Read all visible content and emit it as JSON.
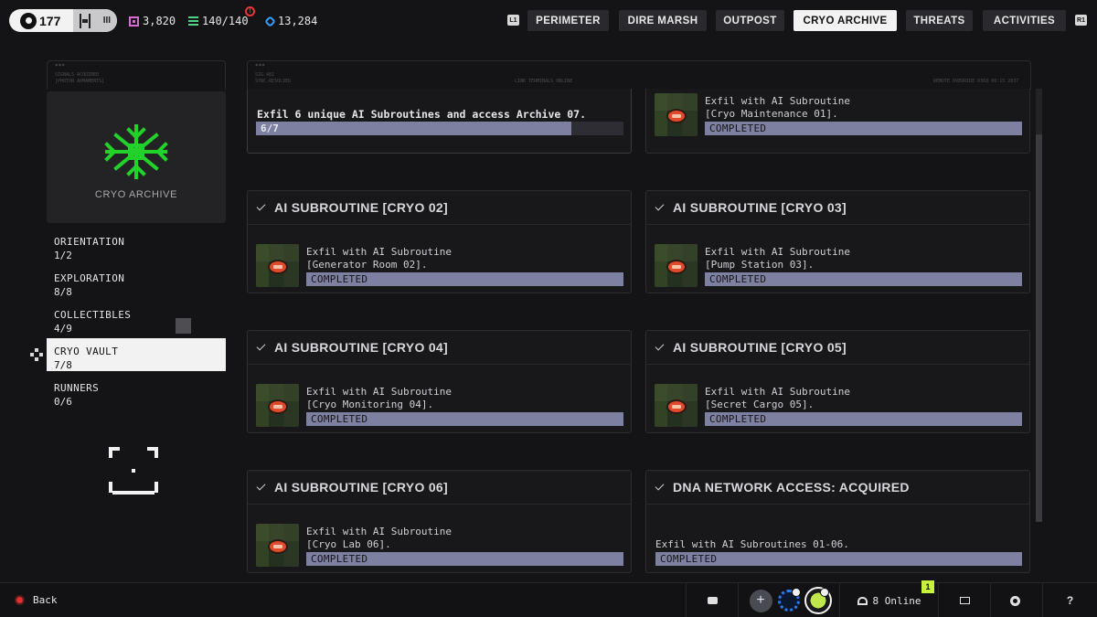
{
  "header": {
    "level": "177",
    "rank": "III",
    "stats": [
      {
        "icon": "cred-icon",
        "value": "3,820",
        "color": "#d86bd8"
      },
      {
        "icon": "storage-icon",
        "value": "140/140",
        "color": "#4fd486"
      },
      {
        "icon": "data-icon",
        "value": "13,284",
        "color": "#3aa0ff"
      }
    ],
    "alert_glyph": "!",
    "nav_hint_left": "L1",
    "nav_hint_right": "R1",
    "tabs": [
      {
        "label": "PERIMETER",
        "active": false
      },
      {
        "label": "DIRE MARSH",
        "active": false
      },
      {
        "label": "OUTPOST",
        "active": false
      },
      {
        "label": "CRYO ARCHIVE",
        "active": true
      },
      {
        "label": "THREATS",
        "active": false
      },
      {
        "label": "ACTIVITIES",
        "active": false
      }
    ]
  },
  "sidebar": {
    "frame_dots": "***",
    "frame_lines": [
      "SIGNALS ACQUIRED",
      "[PHOTON ARMAMENTS]"
    ],
    "emblem_label": "CRYO ARCHIVE",
    "emblem_color": "#22d12a",
    "items": [
      {
        "name": "ORIENTATION",
        "count": "1/2",
        "active": false
      },
      {
        "name": "EXPLORATION",
        "count": "8/8",
        "active": false
      },
      {
        "name": "COLLECTIBLES",
        "count": "4/9",
        "active": false
      },
      {
        "name": "CRYO VAULT",
        "count": "7/8",
        "active": true
      },
      {
        "name": "RUNNERS",
        "count": "0/6",
        "active": false
      }
    ]
  },
  "main": {
    "frame_dots": "***",
    "frame_left": [
      "SIG.481",
      "SYNC.RESOLVED"
    ],
    "frame_center": "LINK TERMINALS ONLINE",
    "frame_right": "REMOTE OVERRIDE 0368 00:15 2037",
    "cards": [
      {
        "title": "",
        "text": "Exfil 6 unique AI Subroutines and access Archive 07.",
        "progress_label": "6/7",
        "progress": 0.857,
        "kind": "progress"
      },
      {
        "title": "",
        "text": "Exfil with AI Subroutine\n[Cryo Maintenance 01].",
        "status": "COMPLETED",
        "kind": "item-top"
      },
      {
        "title": "AI SUBROUTINE [CRYO 02]",
        "text": "Exfil with AI Subroutine\n[Generator Room 02].",
        "status": "COMPLETED",
        "kind": "item"
      },
      {
        "title": "AI SUBROUTINE [CRYO 03]",
        "text": "Exfil with AI Subroutine\n[Pump Station 03].",
        "status": "COMPLETED",
        "kind": "item"
      },
      {
        "title": "AI SUBROUTINE [CRYO 04]",
        "text": "Exfil with AI Subroutine\n[Cryo Monitoring 04].",
        "status": "COMPLETED",
        "kind": "item"
      },
      {
        "title": "AI SUBROUTINE [CRYO 05]",
        "text": "Exfil with AI Subroutine\n[Secret Cargo 05].",
        "status": "COMPLETED",
        "kind": "item"
      },
      {
        "title": "AI SUBROUTINE [CRYO 06]",
        "text": "Exfil with AI Subroutine\n[Cryo Lab 06].",
        "status": "COMPLETED",
        "kind": "item"
      },
      {
        "title": "DNA NETWORK ACCESS: ACQUIRED",
        "text": "Exfil with AI Subroutines 01-06.",
        "status": "COMPLETED",
        "kind": "wide"
      }
    ]
  },
  "footer": {
    "back_label": "Back",
    "online_label": "8 Online",
    "online_badge": "1",
    "plus_glyph": "+",
    "help_glyph": "?"
  }
}
